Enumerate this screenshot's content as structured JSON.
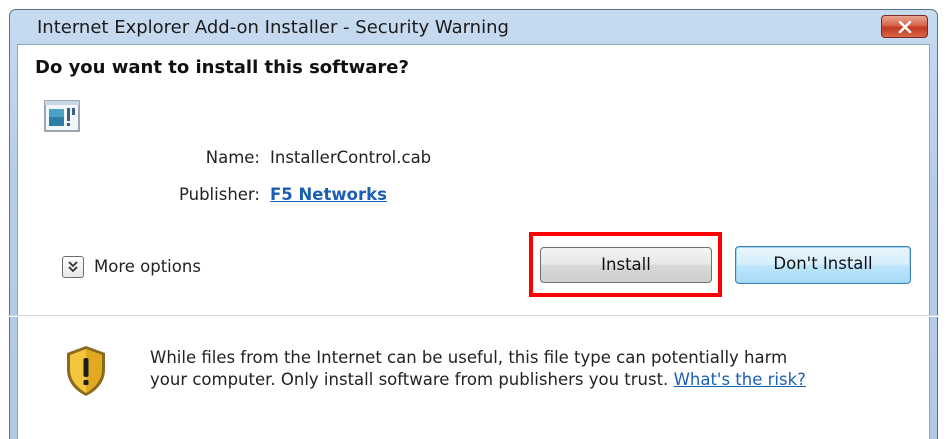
{
  "window": {
    "title": "Internet Explorer Add-on Installer - Security Warning",
    "close_icon": "close-x-icon"
  },
  "dialog": {
    "heading": "Do you want to install this software?",
    "app_icon": "activex-control-icon",
    "name_label": "Name:",
    "name_value": "InstallerControl.cab",
    "publisher_label": "Publisher:",
    "publisher_value": "F5 Networks"
  },
  "options": {
    "more_options_label": "More options",
    "more_options_icon": "double-chevron-down-icon"
  },
  "buttons": {
    "install_label": "Install",
    "dont_install_label": "Don't Install",
    "highlighted": "install"
  },
  "warning": {
    "icon": "shield-warning-icon",
    "line1": "While files from the Internet can be useful, this file type can potentially harm",
    "line2": "your computer. Only install software from publishers you trust.",
    "risk_link": "What's the risk?"
  },
  "colors": {
    "link": "#1b5fb5",
    "highlight": "#ff0000",
    "close_button": "#c2381f"
  }
}
